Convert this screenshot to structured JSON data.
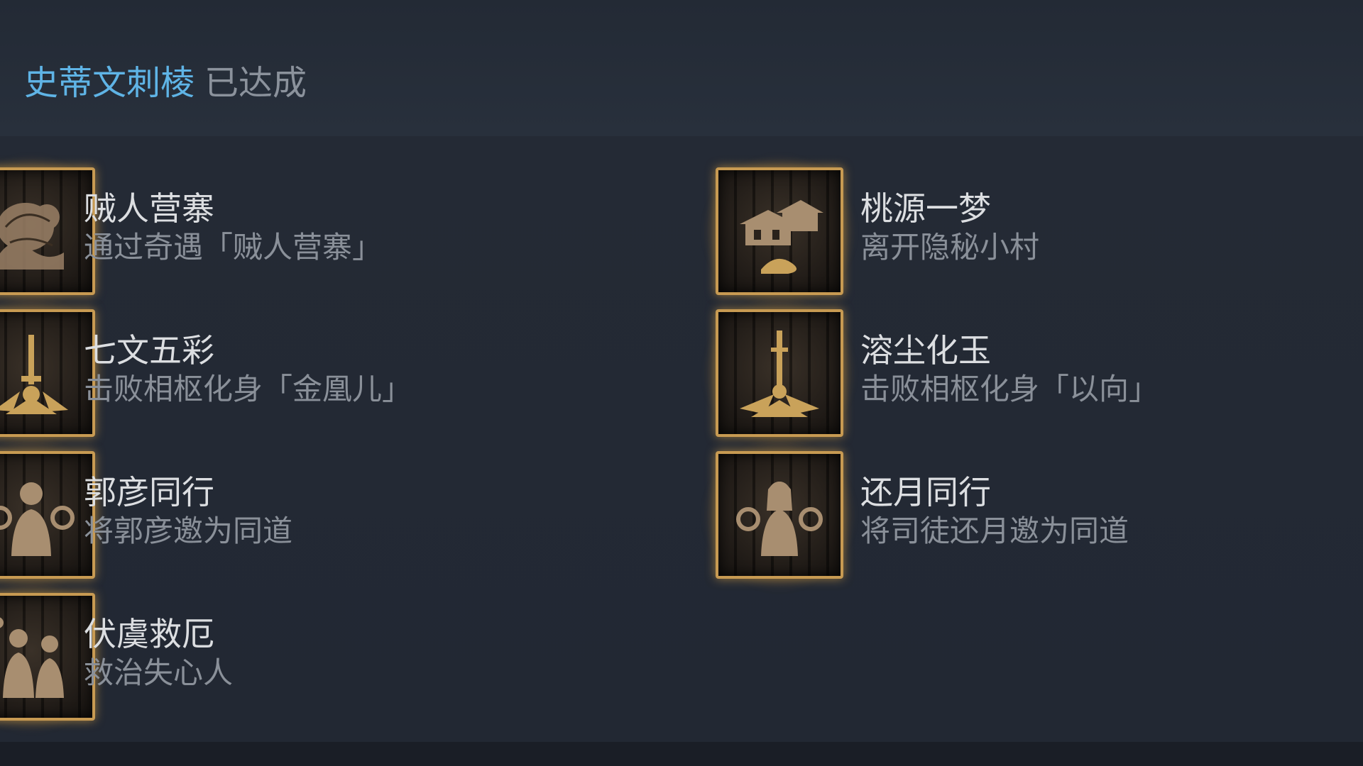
{
  "header": {
    "user_name": "史蒂文刺棱",
    "status": "已达成"
  },
  "achievements": [
    {
      "title": "贼人营寨",
      "description": "通过奇遇「贼人营寨」",
      "icon": "bandit-camp-icon"
    },
    {
      "title": "桃源一梦",
      "description": "离开隐秘小村",
      "icon": "pagoda-village-icon"
    },
    {
      "title": "七文五彩",
      "description": "击败相枢化身「金凰儿」",
      "icon": "ornate-sword-icon"
    },
    {
      "title": "溶尘化玉",
      "description": "击败相枢化身「以向」",
      "icon": "jade-sword-icon"
    },
    {
      "title": "郭彦同行",
      "description": "将郭彦邀为同道",
      "icon": "companion-guo-yan-icon"
    },
    {
      "title": "还月同行",
      "description": "将司徒还月邀为同道",
      "icon": "companion-huan-yue-icon"
    },
    {
      "title": "伏虞救厄",
      "description": "救治失心人",
      "icon": "healer-figures-icon"
    }
  ],
  "colors": {
    "accent_user": "#5fb4e6",
    "frame_gold": "#c79a52",
    "glow": "#e8a840"
  }
}
